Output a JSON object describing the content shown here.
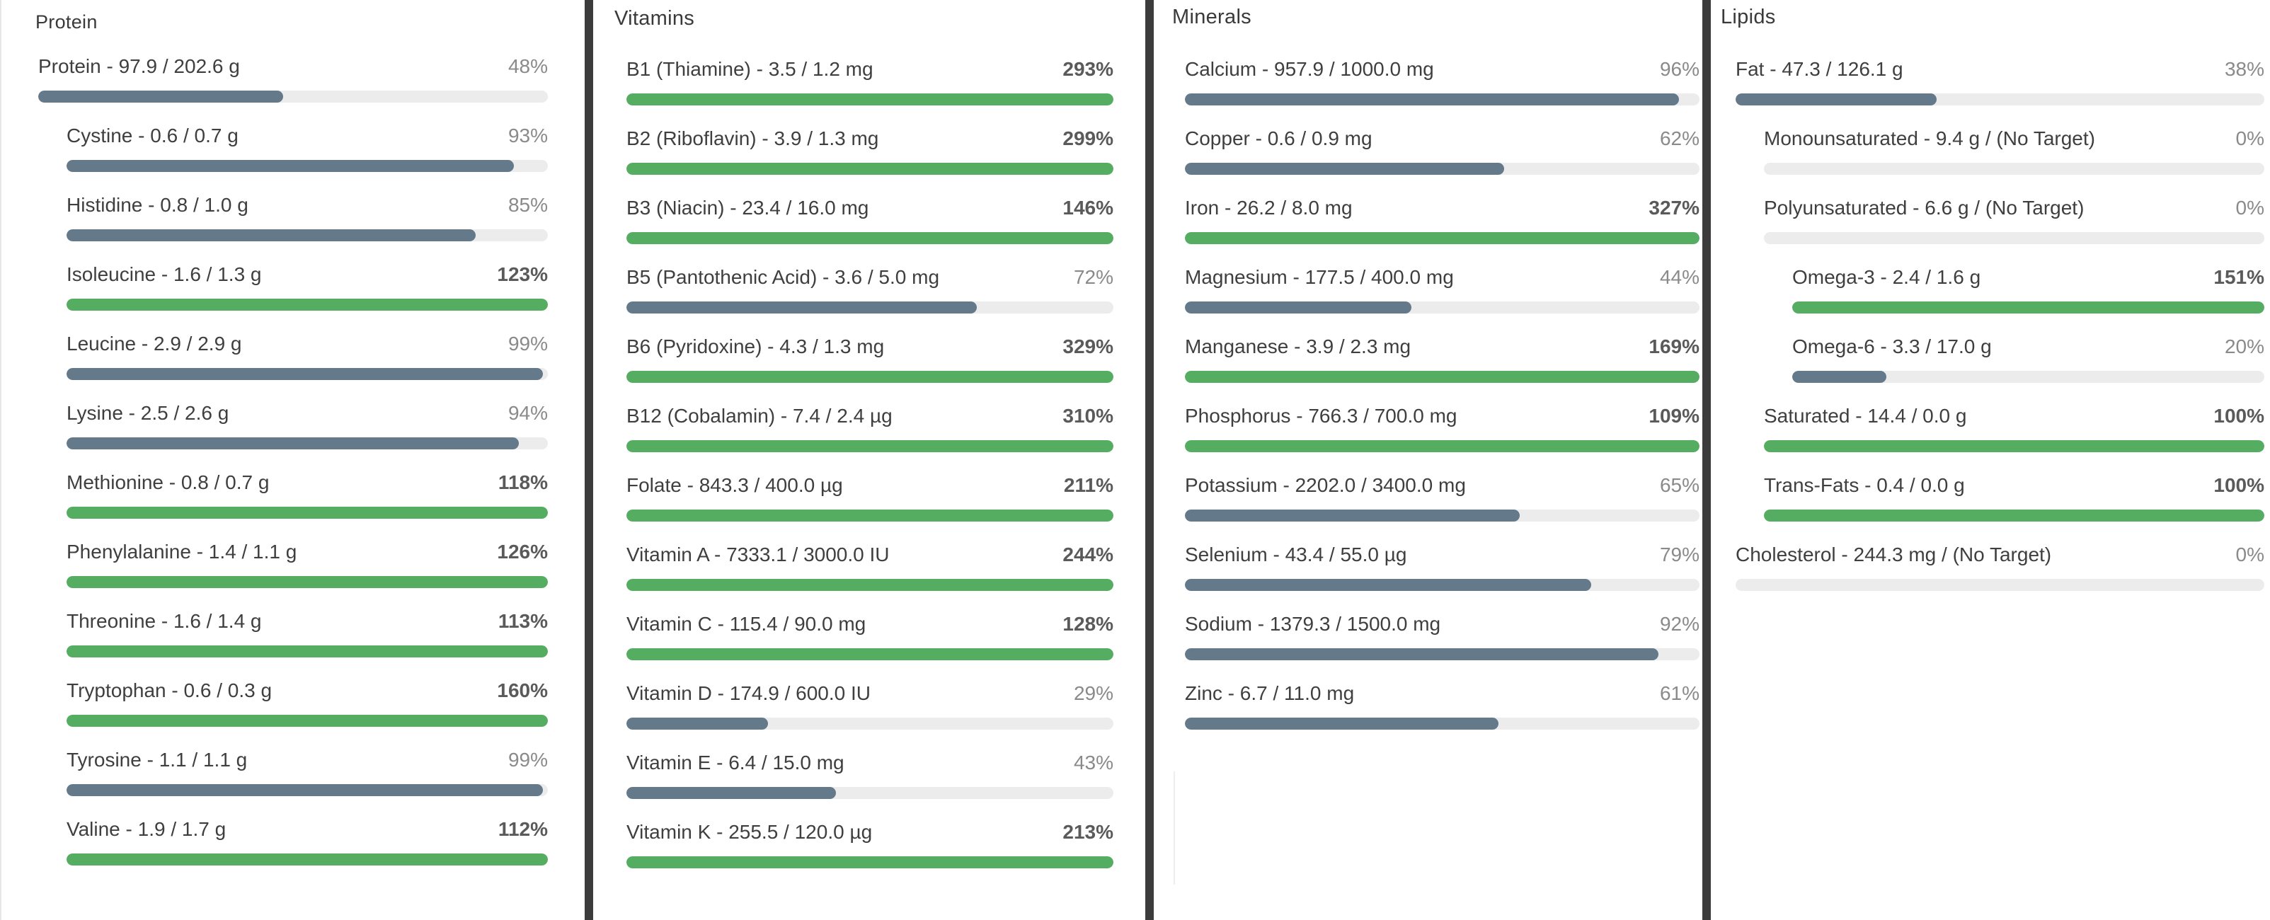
{
  "colors": {
    "bar_under": "#64798a",
    "bar_met": "#55ad62",
    "track": "#ececec",
    "divider": "#3c3c3c"
  },
  "panels": [
    {
      "id": "protein",
      "title": "Protein",
      "rows": [
        {
          "label": "Protein - 97.9 / 202.6 g",
          "pct": "48%",
          "value": 0.48,
          "indent": 0,
          "met": false
        },
        {
          "label": "Cystine - 0.6 / 0.7 g",
          "pct": "93%",
          "value": 0.93,
          "indent": 1,
          "met": false
        },
        {
          "label": "Histidine - 0.8 / 1.0 g",
          "pct": "85%",
          "value": 0.85,
          "indent": 1,
          "met": false
        },
        {
          "label": "Isoleucine - 1.6 / 1.3 g",
          "pct": "123%",
          "value": 1.23,
          "indent": 1,
          "met": true
        },
        {
          "label": "Leucine - 2.9 / 2.9 g",
          "pct": "99%",
          "value": 0.99,
          "indent": 1,
          "met": false
        },
        {
          "label": "Lysine - 2.5 / 2.6 g",
          "pct": "94%",
          "value": 0.94,
          "indent": 1,
          "met": false
        },
        {
          "label": "Methionine - 0.8 / 0.7 g",
          "pct": "118%",
          "value": 1.18,
          "indent": 1,
          "met": true
        },
        {
          "label": "Phenylalanine - 1.4 / 1.1 g",
          "pct": "126%",
          "value": 1.26,
          "indent": 1,
          "met": true
        },
        {
          "label": "Threonine - 1.6 / 1.4 g",
          "pct": "113%",
          "value": 1.13,
          "indent": 1,
          "met": true
        },
        {
          "label": "Tryptophan - 0.6 / 0.3 g",
          "pct": "160%",
          "value": 1.6,
          "indent": 1,
          "met": true
        },
        {
          "label": "Tyrosine - 1.1 / 1.1 g",
          "pct": "99%",
          "value": 0.99,
          "indent": 1,
          "met": false
        },
        {
          "label": "Valine - 1.9 / 1.7 g",
          "pct": "112%",
          "value": 1.12,
          "indent": 1,
          "met": true
        }
      ]
    },
    {
      "id": "vitamins",
      "title": "Vitamins",
      "rows": [
        {
          "label": "B1 (Thiamine) - 3.5 / 1.2 mg",
          "pct": "293%",
          "value": 2.93,
          "indent": 0,
          "met": true
        },
        {
          "label": "B2 (Riboflavin) - 3.9 / 1.3 mg",
          "pct": "299%",
          "value": 2.99,
          "indent": 0,
          "met": true
        },
        {
          "label": "B3 (Niacin) - 23.4 / 16.0 mg",
          "pct": "146%",
          "value": 1.46,
          "indent": 0,
          "met": true
        },
        {
          "label": "B5 (Pantothenic Acid) - 3.6 / 5.0 mg",
          "pct": "72%",
          "value": 0.72,
          "indent": 0,
          "met": false
        },
        {
          "label": "B6 (Pyridoxine) - 4.3 / 1.3 mg",
          "pct": "329%",
          "value": 3.29,
          "indent": 0,
          "met": true
        },
        {
          "label": "B12 (Cobalamin) - 7.4 / 2.4 µg",
          "pct": "310%",
          "value": 3.1,
          "indent": 0,
          "met": true
        },
        {
          "label": "Folate - 843.3 / 400.0 µg",
          "pct": "211%",
          "value": 2.11,
          "indent": 0,
          "met": true
        },
        {
          "label": "Vitamin A - 7333.1 / 3000.0 IU",
          "pct": "244%",
          "value": 2.44,
          "indent": 0,
          "met": true
        },
        {
          "label": "Vitamin C - 115.4 / 90.0 mg",
          "pct": "128%",
          "value": 1.28,
          "indent": 0,
          "met": true
        },
        {
          "label": "Vitamin D - 174.9 / 600.0 IU",
          "pct": "29%",
          "value": 0.29,
          "indent": 0,
          "met": false
        },
        {
          "label": "Vitamin E - 6.4 / 15.0 mg",
          "pct": "43%",
          "value": 0.43,
          "indent": 0,
          "met": false
        },
        {
          "label": "Vitamin K - 255.5 / 120.0 µg",
          "pct": "213%",
          "value": 2.13,
          "indent": 0,
          "met": true
        }
      ]
    },
    {
      "id": "minerals",
      "title": "Minerals",
      "rows": [
        {
          "label": "Calcium - 957.9 / 1000.0 mg",
          "pct": "96%",
          "value": 0.96,
          "indent": 0,
          "met": false
        },
        {
          "label": "Copper - 0.6 / 0.9 mg",
          "pct": "62%",
          "value": 0.62,
          "indent": 0,
          "met": false
        },
        {
          "label": "Iron - 26.2 / 8.0 mg",
          "pct": "327%",
          "value": 3.27,
          "indent": 0,
          "met": true
        },
        {
          "label": "Magnesium - 177.5 / 400.0 mg",
          "pct": "44%",
          "value": 0.44,
          "indent": 0,
          "met": false
        },
        {
          "label": "Manganese - 3.9 / 2.3 mg",
          "pct": "169%",
          "value": 1.69,
          "indent": 0,
          "met": true
        },
        {
          "label": "Phosphorus - 766.3 / 700.0 mg",
          "pct": "109%",
          "value": 1.09,
          "indent": 0,
          "met": true
        },
        {
          "label": "Potassium - 2202.0 / 3400.0 mg",
          "pct": "65%",
          "value": 0.65,
          "indent": 0,
          "met": false
        },
        {
          "label": "Selenium - 43.4 / 55.0 µg",
          "pct": "79%",
          "value": 0.79,
          "indent": 0,
          "met": false
        },
        {
          "label": "Sodium - 1379.3 / 1500.0 mg",
          "pct": "92%",
          "value": 0.92,
          "indent": 0,
          "met": false
        },
        {
          "label": "Zinc - 6.7 / 11.0 mg",
          "pct": "61%",
          "value": 0.61,
          "indent": 0,
          "met": false
        }
      ]
    },
    {
      "id": "lipids",
      "title": "Lipids",
      "rows": [
        {
          "label": "Fat - 47.3 / 126.1 g",
          "pct": "38%",
          "value": 0.38,
          "indent": 0,
          "met": false
        },
        {
          "label": "Monounsaturated - 9.4 g / (No Target)",
          "pct": "0%",
          "value": 0,
          "indent": 1,
          "met": false
        },
        {
          "label": "Polyunsaturated - 6.6 g / (No Target)",
          "pct": "0%",
          "value": 0,
          "indent": 1,
          "met": false
        },
        {
          "label": "Omega-3 - 2.4 / 1.6 g",
          "pct": "151%",
          "value": 1.51,
          "indent": 2,
          "met": true
        },
        {
          "label": "Omega-6 - 3.3 / 17.0 g",
          "pct": "20%",
          "value": 0.2,
          "indent": 2,
          "met": false
        },
        {
          "label": "Saturated - 14.4 / 0.0 g",
          "pct": "100%",
          "value": 1.0,
          "indent": 1,
          "met": true
        },
        {
          "label": "Trans-Fats - 0.4 / 0.0 g",
          "pct": "100%",
          "value": 1.0,
          "indent": 1,
          "met": true
        },
        {
          "label": "Cholesterol - 244.3 mg / (No Target)",
          "pct": "0%",
          "value": 0,
          "indent": 0,
          "met": false
        }
      ]
    }
  ]
}
